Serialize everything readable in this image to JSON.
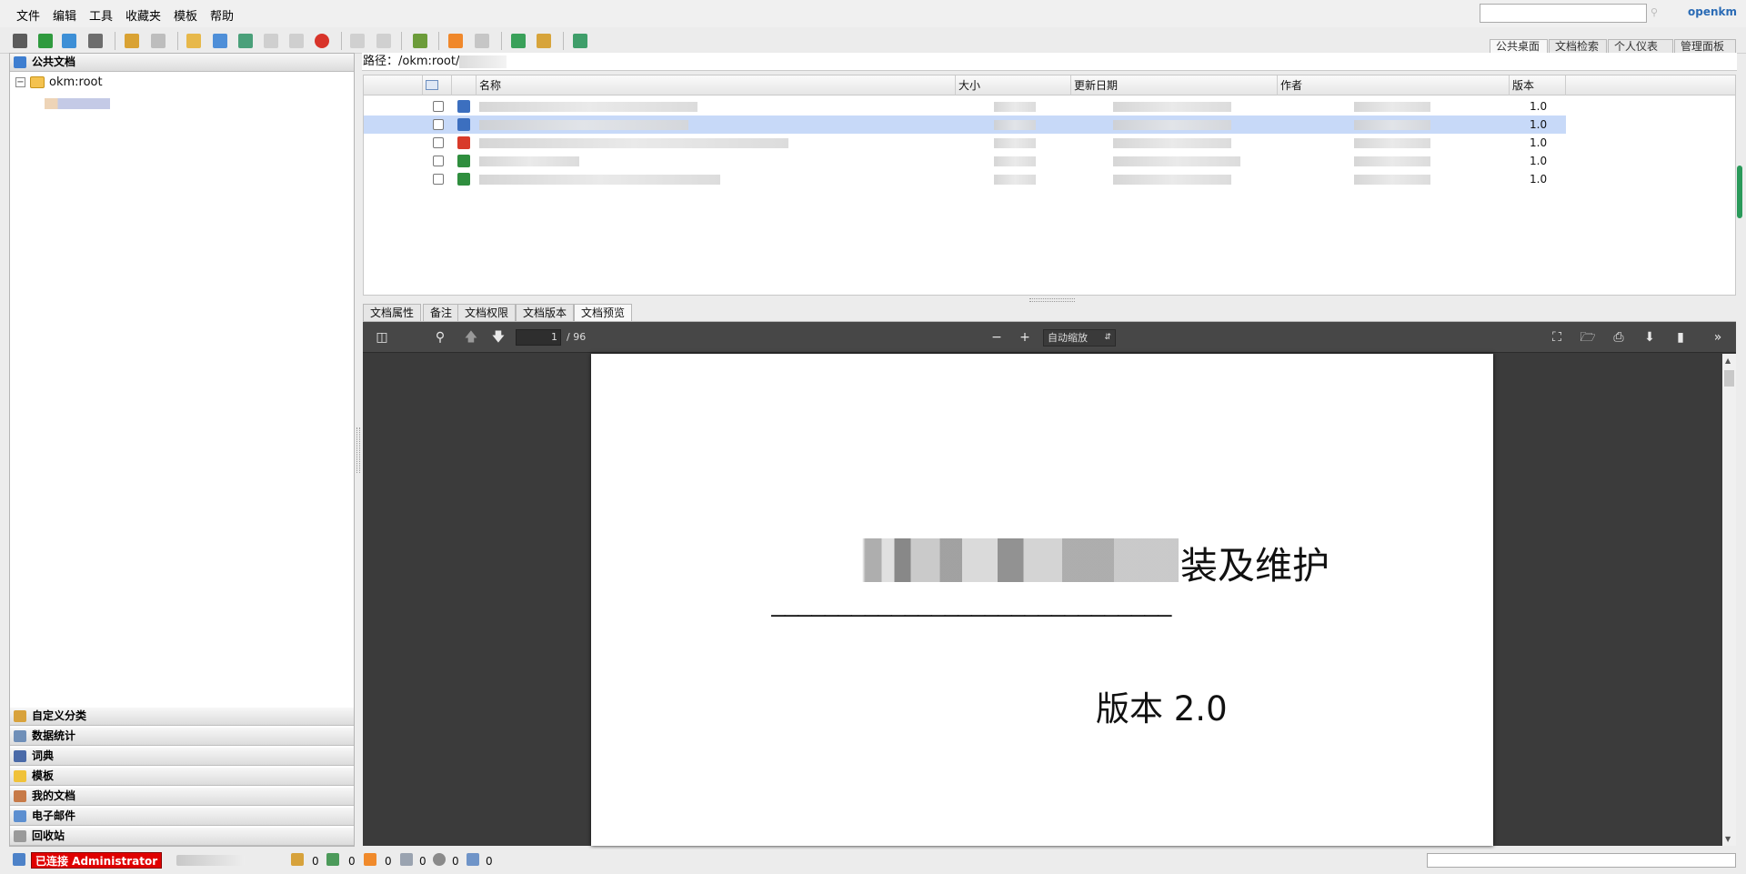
{
  "menu": [
    "文件",
    "编辑",
    "工具",
    "收藏夹",
    "模板",
    "帮助"
  ],
  "logo": "openkm",
  "search": {
    "placeholder": ""
  },
  "top_tabs": [
    "公共桌面",
    "文档检索",
    "个人仪表盘",
    "管理面板"
  ],
  "left_panel": {
    "header": "公共文档",
    "tree_root": "okm:root",
    "sections": [
      "自定义分类",
      "数据统计",
      "词典",
      "模板",
      "我的文档",
      "电子邮件",
      "回收站"
    ]
  },
  "path": {
    "label": "路径：/okm:root/"
  },
  "file_table": {
    "headers": {
      "name": "名称",
      "size": "大小",
      "date": "更新日期",
      "author": "作者",
      "version": "版本"
    },
    "rows": [
      {
        "type": "word",
        "version": "1.0",
        "selected": false
      },
      {
        "type": "word",
        "version": "1.0",
        "selected": true
      },
      {
        "type": "pdf",
        "version": "1.0",
        "selected": false
      },
      {
        "type": "excel",
        "version": "1.0",
        "selected": false
      },
      {
        "type": "excel",
        "version": "1.0",
        "selected": false
      }
    ]
  },
  "doc_tabs": [
    "文档属性",
    "备注",
    "文档权限",
    "文档版本",
    "文档预览"
  ],
  "pdf": {
    "page_current": "1",
    "page_total": "/ 96",
    "zoom": "自动缩放",
    "title_visible": "装及维护",
    "separator_line": "——————————————————————————————",
    "version_text": "版本 2.0"
  },
  "status": {
    "connection": "已连接 Administrator",
    "counts": [
      "0",
      "0",
      "0",
      "0",
      "0",
      "0"
    ]
  },
  "colors": {
    "selected_row": "#c7d9f8",
    "connected": "#e00000",
    "pdf_toolbar": "#474747"
  }
}
